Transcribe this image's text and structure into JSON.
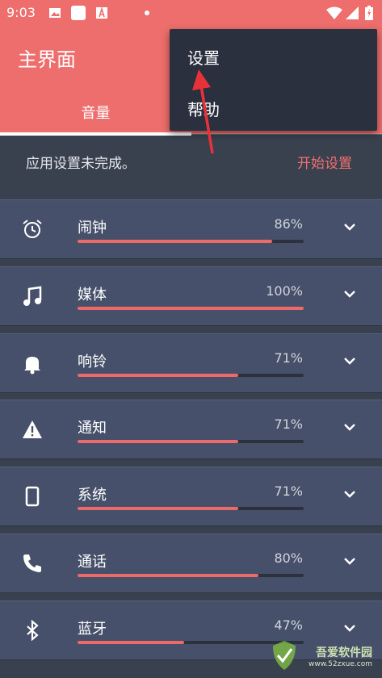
{
  "status_bar": {
    "time": "9:03",
    "background": "#ed6e6c",
    "icons": [
      "image-icon",
      "square-icon",
      "app-a-icon",
      "dot-icon",
      "wifi-icon",
      "signal-icon",
      "battery-icon"
    ]
  },
  "header": {
    "title": "主界面",
    "tab_label": "音量",
    "background": "#ed6e6c"
  },
  "banner": {
    "message": "应用设置未完成。",
    "action": "开始设置",
    "action_color": "#ee6f6e"
  },
  "volume_items": [
    {
      "label": "闹钟",
      "percent_text": "86%",
      "level": 0.86,
      "icon": "alarm-clock-icon"
    },
    {
      "label": "媒体",
      "percent_text": "100%",
      "level": 1.0,
      "icon": "music-note-icon"
    },
    {
      "label": "响铃",
      "percent_text": "71%",
      "level": 0.71,
      "icon": "bell-icon"
    },
    {
      "label": "通知",
      "percent_text": "71%",
      "level": 0.71,
      "icon": "warning-icon"
    },
    {
      "label": "系统",
      "percent_text": "71%",
      "level": 0.71,
      "icon": "phone-device-icon"
    },
    {
      "label": "通话",
      "percent_text": "80%",
      "level": 0.8,
      "icon": "phone-call-icon"
    },
    {
      "label": "蓝牙",
      "percent_text": "47%",
      "level": 0.47,
      "icon": "bluetooth-icon"
    }
  ],
  "menu": {
    "items": [
      "设置",
      "帮助"
    ]
  },
  "colors": {
    "background": "#39414f",
    "card": "#46506a",
    "slider_fill": "#ec6a68",
    "slider_track": "#2b323e",
    "menu_bg": "#2b303e",
    "arrow": "#e8323a"
  },
  "watermark": {
    "text": "吾爱软件园",
    "sub": "www.52zxue.com"
  }
}
